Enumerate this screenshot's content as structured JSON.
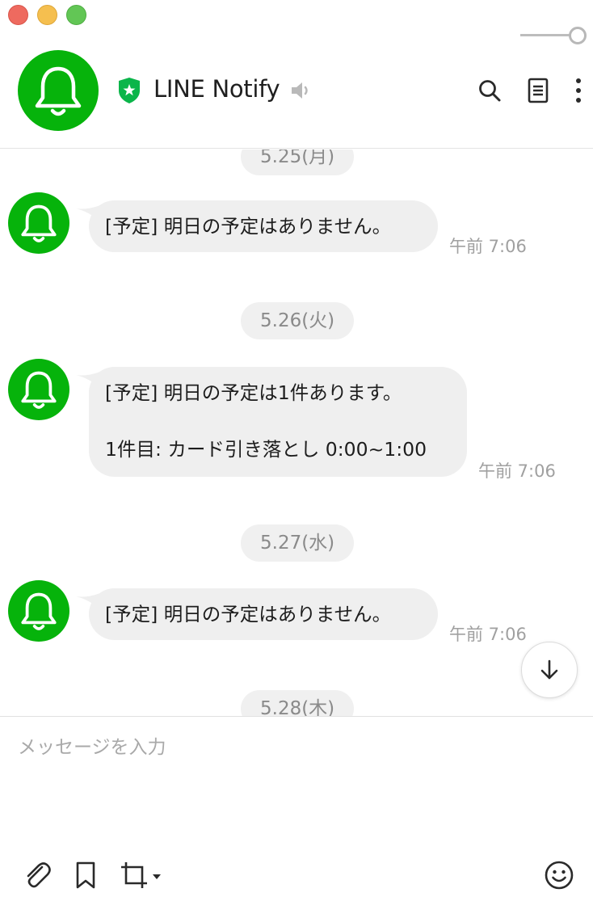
{
  "window": {
    "controls": [
      "close",
      "minimize",
      "zoom"
    ]
  },
  "header": {
    "title": "LINE Notify",
    "avatar_icon": "bell-icon",
    "verified_icon": "shield-star-icon",
    "muted_icon": "speaker-icon",
    "actions": [
      {
        "name": "search",
        "icon": "search-icon"
      },
      {
        "name": "notes",
        "icon": "note-icon"
      },
      {
        "name": "more",
        "icon": "more-vertical-icon"
      }
    ]
  },
  "colors": {
    "brand_green": "#06b30b",
    "bubble": "#efefef",
    "date_chip": "#f0f0f0"
  },
  "messages": {
    "groups": [
      {
        "date": "5.25(月)",
        "lines": [
          "[予定] 明日の予定はありません。"
        ],
        "time": "午前 7:06"
      },
      {
        "date": "5.26(火)",
        "lines": [
          "[予定] 明日の予定は1件あります。",
          "1件目: カード引き落とし 0:00~1:00"
        ],
        "time": "午前 7:06"
      },
      {
        "date": "5.27(水)",
        "lines": [
          "[予定] 明日の予定はありません。"
        ],
        "time": "午前 7:06"
      },
      {
        "date": "5.28(木)"
      }
    ]
  },
  "composer": {
    "placeholder": "メッセージを入力",
    "tools": [
      "paperclip-icon",
      "bookmark-icon",
      "crop-icon",
      "emoji-icon"
    ]
  }
}
